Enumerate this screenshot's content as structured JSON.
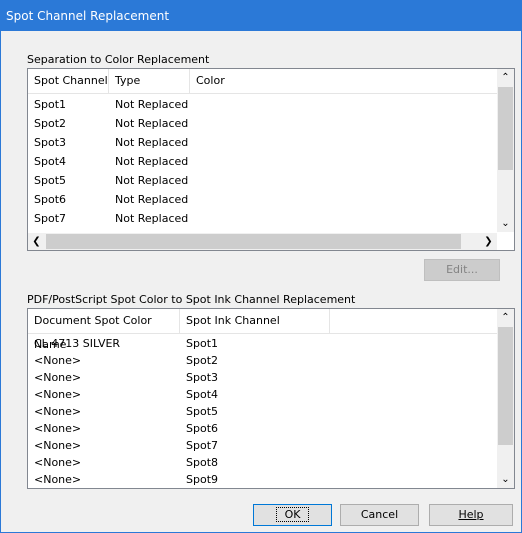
{
  "window": {
    "title": "Spot Channel Replacement"
  },
  "separation": {
    "label": "Separation to Color Replacement",
    "columns": [
      "Spot Channel",
      "Type",
      "Color"
    ],
    "rows": [
      {
        "spot": "Spot1",
        "type": "Not Replaced",
        "color": ""
      },
      {
        "spot": "Spot2",
        "type": "Not Replaced",
        "color": ""
      },
      {
        "spot": "Spot3",
        "type": "Not Replaced",
        "color": ""
      },
      {
        "spot": "Spot4",
        "type": "Not Replaced",
        "color": ""
      },
      {
        "spot": "Spot5",
        "type": "Not Replaced",
        "color": ""
      },
      {
        "spot": "Spot6",
        "type": "Not Replaced",
        "color": ""
      },
      {
        "spot": "Spot7",
        "type": "Not Replaced",
        "color": ""
      }
    ],
    "edit_label": "Edit..."
  },
  "pdf": {
    "label": "PDF/PostScript Spot Color to Spot Ink Channel Replacement",
    "columns": [
      "Document Spot Color Name",
      "Spot Ink Channel"
    ],
    "rows": [
      {
        "name": "CL 4713 SILVER",
        "channel": "Spot1"
      },
      {
        "name": "<None>",
        "channel": "Spot2"
      },
      {
        "name": "<None>",
        "channel": "Spot3"
      },
      {
        "name": "<None>",
        "channel": "Spot4"
      },
      {
        "name": "<None>",
        "channel": "Spot5"
      },
      {
        "name": "<None>",
        "channel": "Spot6"
      },
      {
        "name": "<None>",
        "channel": "Spot7"
      },
      {
        "name": "<None>",
        "channel": "Spot8"
      },
      {
        "name": "<None>",
        "channel": "Spot9"
      }
    ]
  },
  "buttons": {
    "ok": "OK",
    "cancel": "Cancel",
    "help": "Help"
  },
  "colors": {
    "titlebar": "#2b79d7"
  }
}
